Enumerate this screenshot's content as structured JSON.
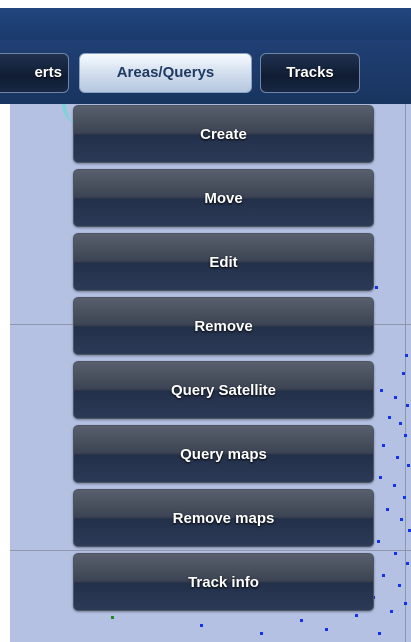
{
  "tabs": [
    {
      "label": "erts"
    },
    {
      "label": "Areas/Querys"
    },
    {
      "label": "Tracks"
    }
  ],
  "menu": {
    "items": [
      {
        "label": "Create"
      },
      {
        "label": "Move"
      },
      {
        "label": "Edit"
      },
      {
        "label": "Remove"
      },
      {
        "label": "Query Satellite"
      },
      {
        "label": "Query maps"
      },
      {
        "label": "Remove maps"
      },
      {
        "label": "Track info"
      }
    ]
  },
  "colors": {
    "header": "#1a3a6c",
    "map_background": "#b4c1e2",
    "track_points": "#1333e8"
  }
}
